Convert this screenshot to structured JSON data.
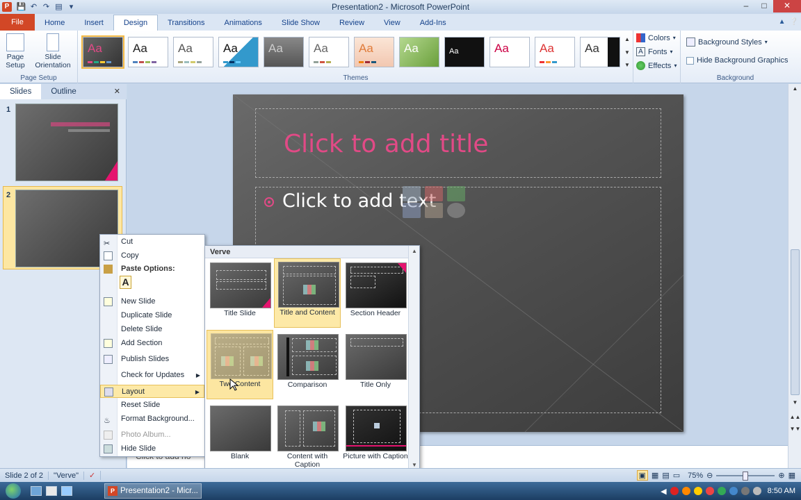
{
  "window": {
    "title": "Presentation2 - Microsoft PowerPoint",
    "app_icon": "P"
  },
  "tabs": [
    "File",
    "Home",
    "Insert",
    "Design",
    "Transitions",
    "Animations",
    "Slide Show",
    "Review",
    "View",
    "Add-Ins"
  ],
  "ribbon": {
    "page_setup": {
      "page_setup_label": "Page Setup",
      "orientation_label": "Slide Orientation",
      "group_label": "Page Setup"
    },
    "themes": {
      "group_label": "Themes",
      "sample": "Aa"
    },
    "theme_options": {
      "colors": "Colors",
      "fonts": "Fonts",
      "effects": "Effects"
    },
    "background": {
      "styles": "Background Styles",
      "hide_graphics": "Hide Background Graphics",
      "group_label": "Background"
    }
  },
  "left_panel": {
    "tab_slides": "Slides",
    "tab_outline": "Outline",
    "thumb_1": "1",
    "thumb_2": "2"
  },
  "slide": {
    "title_placeholder": "Click to add title",
    "body_placeholder": "Click to add text"
  },
  "notes_partial": "Click to add no",
  "context_menu": {
    "cut": "Cut",
    "copy": "Copy",
    "paste_options": "Paste Options:",
    "paste_keep": "A",
    "new_slide": "New Slide",
    "duplicate_slide": "Duplicate Slide",
    "delete_slide": "Delete Slide",
    "add_section": "Add Section",
    "publish_slides": "Publish Slides",
    "check_updates": "Check for Updates",
    "layout": "Layout",
    "reset_slide": "Reset Slide",
    "format_background": "Format Background...",
    "photo_album": "Photo Album...",
    "hide_slide": "Hide Slide"
  },
  "layout_gallery": {
    "header": "Verve",
    "items": {
      "title_slide": "Title Slide",
      "title_content": "Title and Content",
      "section_header": "Section Header",
      "two_content": "Two Content",
      "comparison": "Comparison",
      "title_only": "Title Only",
      "blank": "Blank",
      "content_caption": "Content with Caption",
      "picture_caption": "Picture with Caption"
    }
  },
  "status": {
    "slide_of": "Slide 2 of 2",
    "theme": "\"Verve\"",
    "zoom": "75%"
  },
  "taskbar": {
    "window_button": "Presentation2 - Micr...",
    "clock": "8:50 AM"
  },
  "colors": {
    "accent_pink": "#e14a86",
    "file_tab": "#d24726",
    "hover": "#fde9a7"
  }
}
